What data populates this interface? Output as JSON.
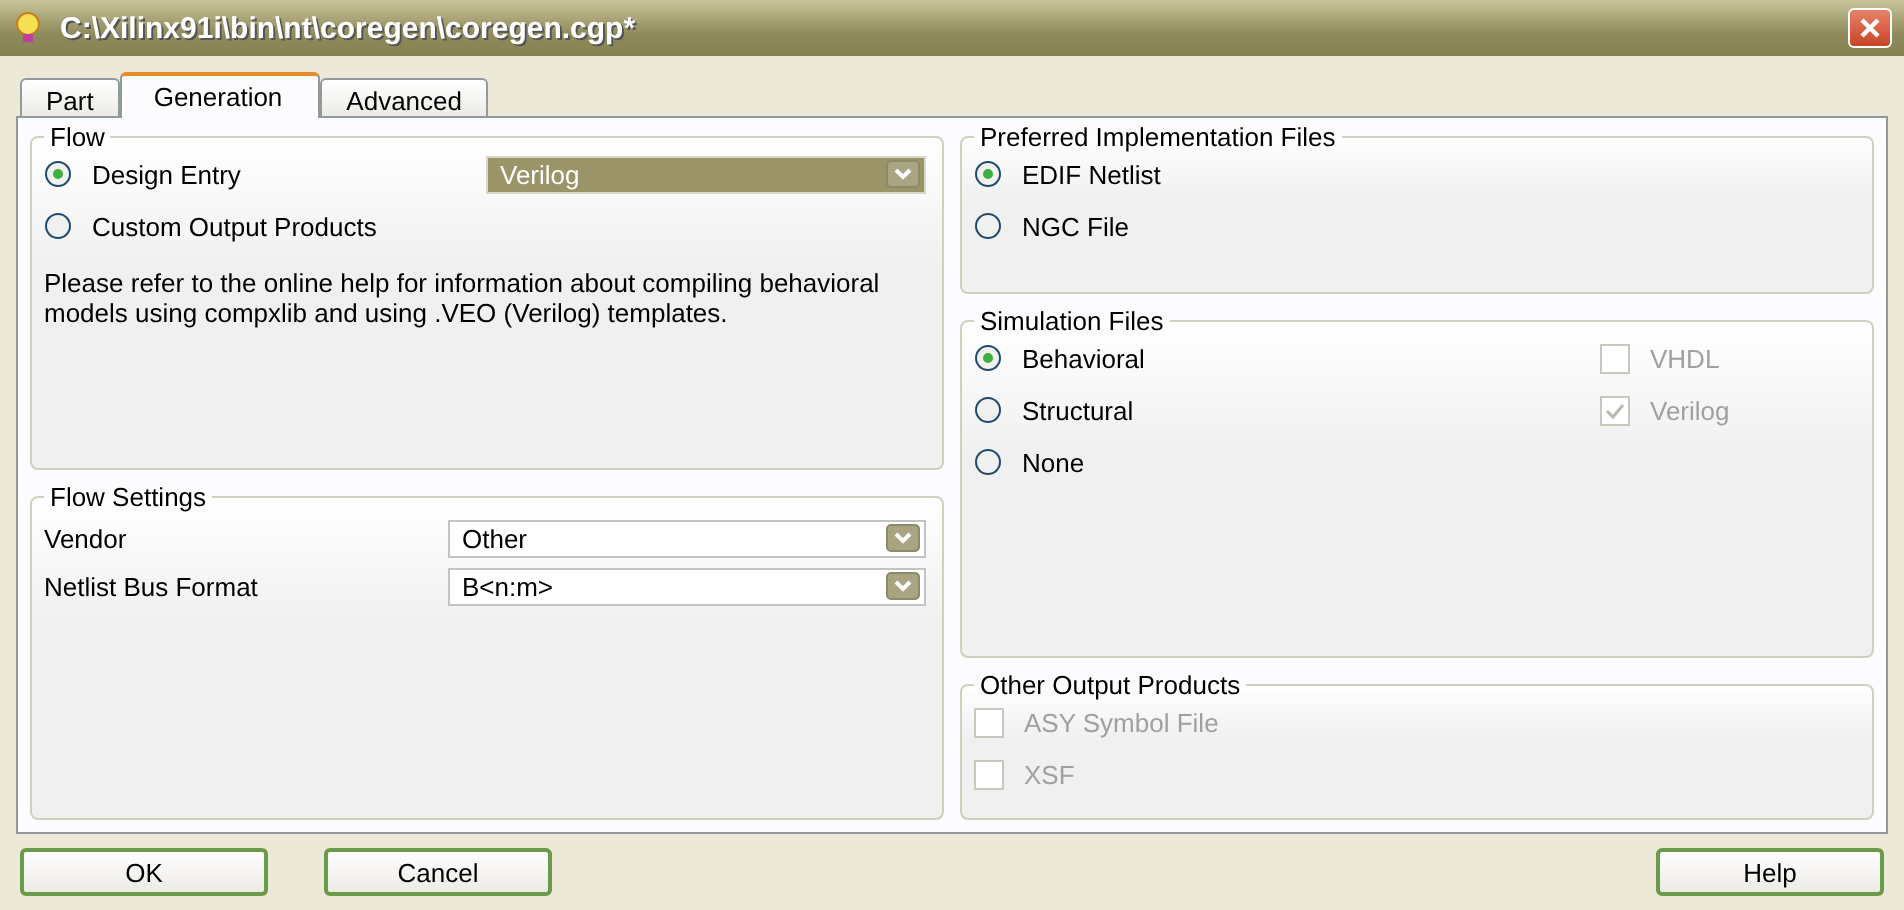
{
  "window": {
    "title": "C:\\Xilinx91i\\bin\\nt\\coregen\\coregen.cgp*"
  },
  "tabs": [
    {
      "label": "Part",
      "selected": false
    },
    {
      "label": "Generation",
      "selected": true
    },
    {
      "label": "Advanced",
      "selected": false
    }
  ],
  "flow": {
    "title": "Flow",
    "options": [
      {
        "label": "Design Entry",
        "selected": true
      },
      {
        "label": "Custom Output Products",
        "selected": false
      }
    ],
    "dropdown": {
      "value": "Verilog",
      "focused": true
    },
    "note": "Please refer to the online help for information about compiling behavioral models using compxlib and using .VEO (Verilog) templates."
  },
  "flow_settings": {
    "title": "Flow Settings",
    "fields": [
      {
        "label": "Vendor",
        "value": "Other"
      },
      {
        "label": "Netlist Bus Format",
        "value": "B<n:m>"
      }
    ]
  },
  "preferred_implementation_files": {
    "title": "Preferred Implementation Files",
    "options": [
      {
        "label": "EDIF Netlist",
        "selected": true
      },
      {
        "label": "NGC File",
        "selected": false
      }
    ]
  },
  "simulation_files": {
    "title": "Simulation Files",
    "options": [
      {
        "label": "Behavioral",
        "selected": true
      },
      {
        "label": "Structural",
        "selected": false
      },
      {
        "label": "None",
        "selected": false
      }
    ],
    "checkboxes": [
      {
        "label": "VHDL",
        "checked": false,
        "disabled": true
      },
      {
        "label": "Verilog",
        "checked": true,
        "disabled": true
      }
    ]
  },
  "other_output_products": {
    "title": "Other Output Products",
    "checkboxes": [
      {
        "label": "ASY Symbol File",
        "checked": false,
        "disabled": true
      },
      {
        "label": "XSF",
        "checked": false,
        "disabled": true
      }
    ]
  },
  "buttons_left": [
    "OK",
    "Cancel"
  ],
  "buttons_right": [
    "Help"
  ]
}
